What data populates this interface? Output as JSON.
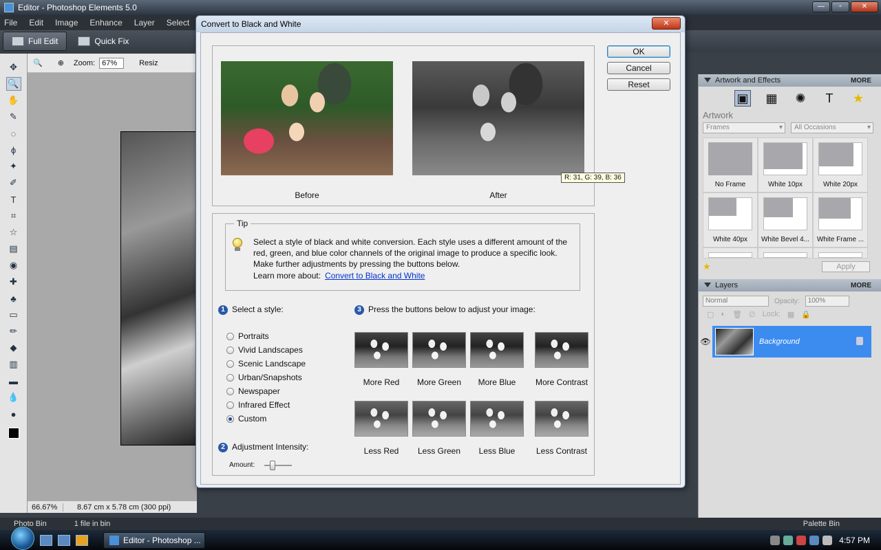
{
  "window": {
    "title": "Editor - Photoshop Elements 5.0"
  },
  "menu": [
    "File",
    "Edit",
    "Image",
    "Enhance",
    "Layer",
    "Select"
  ],
  "modes": {
    "full_edit": "Full Edit",
    "quick_fix": "Quick Fix"
  },
  "options": {
    "zoom_label": "Zoom:",
    "zoom_value": "67%",
    "resize_label": "Resiz"
  },
  "status": {
    "zoom": "66.67%",
    "doc_info": "8.67 cm x 5.78 cm (300 ppi)"
  },
  "bin": {
    "photo_bin": "Photo Bin",
    "count": "1 file in bin",
    "palette_bin": "Palette Bin"
  },
  "taskbar": {
    "task_label": "Editor - Photoshop ...",
    "clock": "4:57 PM"
  },
  "artwork_panel": {
    "title": "Artwork and Effects",
    "more": "MORE",
    "section": "Artwork",
    "category": "Frames",
    "occasion": "All Occasions",
    "frames": [
      "No Frame",
      "White 10px",
      "White 20px",
      "White 40px",
      "White Bevel 4...",
      "White Frame ..."
    ],
    "apply": "Apply"
  },
  "layers_panel": {
    "title": "Layers",
    "more": "MORE",
    "blend_mode": "Normal",
    "opacity_label": "Opacity:",
    "opacity_value": "100%",
    "lock_label": "Lock:",
    "layer_name": "Background"
  },
  "dialog": {
    "title": "Convert to Black and White",
    "ok": "OK",
    "cancel": "Cancel",
    "reset": "Reset",
    "before_label": "Before",
    "after_label": "After",
    "rgb_readout": "R: 31, G: 39, B: 36",
    "tip_legend": "Tip",
    "tip_text": "Select a style of black and white conversion. Each style uses a different amount of the red, green, and blue color channels of the original image to produce a specific look. Make further adjustments by pressing the buttons below.",
    "learn_more": "Learn more about:",
    "learn_link": "Convert to Black and White",
    "step1": "Select a style:",
    "step2": "Adjustment Intensity:",
    "step3": "Press the buttons below to adjust your image:",
    "amount_label": "Amount:",
    "amount_value": 0.25,
    "styles": [
      "Portraits",
      "Vivid Landscapes",
      "Scenic Landscape",
      "Urban/Snapshots",
      "Newspaper",
      "Infrared Effect",
      "Custom"
    ],
    "selected_style": "Custom",
    "adjust_more": [
      "More Red",
      "More Green",
      "More Blue",
      "More Contrast"
    ],
    "adjust_less": [
      "Less Red",
      "Less Green",
      "Less Blue",
      "Less Contrast"
    ]
  }
}
